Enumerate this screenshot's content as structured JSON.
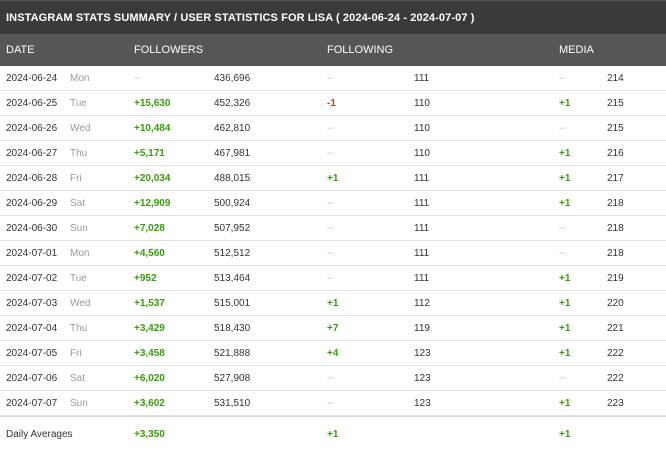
{
  "title": "INSTAGRAM STATS SUMMARY / USER STATISTICS FOR LISA ( 2024-06-24 - 2024-07-07 )",
  "columns": {
    "date": "DATE",
    "followers": "FOLLOWERS",
    "following": "FOLLOWING",
    "media": "MEDIA"
  },
  "rows": [
    {
      "date": "2024-06-24",
      "day": "Mon",
      "followers_delta": "--",
      "followers": "436,696",
      "following_delta": "--",
      "following": "111",
      "media_delta": "--",
      "media": "214"
    },
    {
      "date": "2024-06-25",
      "day": "Tue",
      "followers_delta": "+15,630",
      "followers": "452,326",
      "following_delta": "-1",
      "following": "110",
      "media_delta": "+1",
      "media": "215"
    },
    {
      "date": "2024-06-26",
      "day": "Wed",
      "followers_delta": "+10,484",
      "followers": "462,810",
      "following_delta": "--",
      "following": "110",
      "media_delta": "--",
      "media": "215"
    },
    {
      "date": "2024-06-27",
      "day": "Thu",
      "followers_delta": "+5,171",
      "followers": "467,981",
      "following_delta": "--",
      "following": "110",
      "media_delta": "+1",
      "media": "216"
    },
    {
      "date": "2024-06-28",
      "day": "Fri",
      "followers_delta": "+20,034",
      "followers": "488,015",
      "following_delta": "+1",
      "following": "111",
      "media_delta": "+1",
      "media": "217"
    },
    {
      "date": "2024-06-29",
      "day": "Sat",
      "followers_delta": "+12,909",
      "followers": "500,924",
      "following_delta": "--",
      "following": "111",
      "media_delta": "+1",
      "media": "218"
    },
    {
      "date": "2024-06-30",
      "day": "Sun",
      "followers_delta": "+7,028",
      "followers": "507,952",
      "following_delta": "--",
      "following": "111",
      "media_delta": "--",
      "media": "218"
    },
    {
      "date": "2024-07-01",
      "day": "Mon",
      "followers_delta": "+4,560",
      "followers": "512,512",
      "following_delta": "--",
      "following": "111",
      "media_delta": "--",
      "media": "218"
    },
    {
      "date": "2024-07-02",
      "day": "Tue",
      "followers_delta": "+952",
      "followers": "513,464",
      "following_delta": "--",
      "following": "111",
      "media_delta": "+1",
      "media": "219"
    },
    {
      "date": "2024-07-03",
      "day": "Wed",
      "followers_delta": "+1,537",
      "followers": "515,001",
      "following_delta": "+1",
      "following": "112",
      "media_delta": "+1",
      "media": "220"
    },
    {
      "date": "2024-07-04",
      "day": "Thu",
      "followers_delta": "+3,429",
      "followers": "518,430",
      "following_delta": "+7",
      "following": "119",
      "media_delta": "+1",
      "media": "221"
    },
    {
      "date": "2024-07-05",
      "day": "Fri",
      "followers_delta": "+3,458",
      "followers": "521,888",
      "following_delta": "+4",
      "following": "123",
      "media_delta": "+1",
      "media": "222"
    },
    {
      "date": "2024-07-06",
      "day": "Sat",
      "followers_delta": "+6,020",
      "followers": "527,908",
      "following_delta": "--",
      "following": "123",
      "media_delta": "--",
      "media": "222"
    },
    {
      "date": "2024-07-07",
      "day": "Sun",
      "followers_delta": "+3,602",
      "followers": "531,510",
      "following_delta": "--",
      "following": "123",
      "media_delta": "+1",
      "media": "223"
    }
  ],
  "averages": {
    "label": "Daily Averages",
    "followers_delta": "+3,350",
    "following_delta": "+1",
    "media_delta": "+1"
  },
  "colors": {
    "positive": "#3a9a12",
    "negative": "#d83b12",
    "neutral": "#bbbbbb"
  }
}
